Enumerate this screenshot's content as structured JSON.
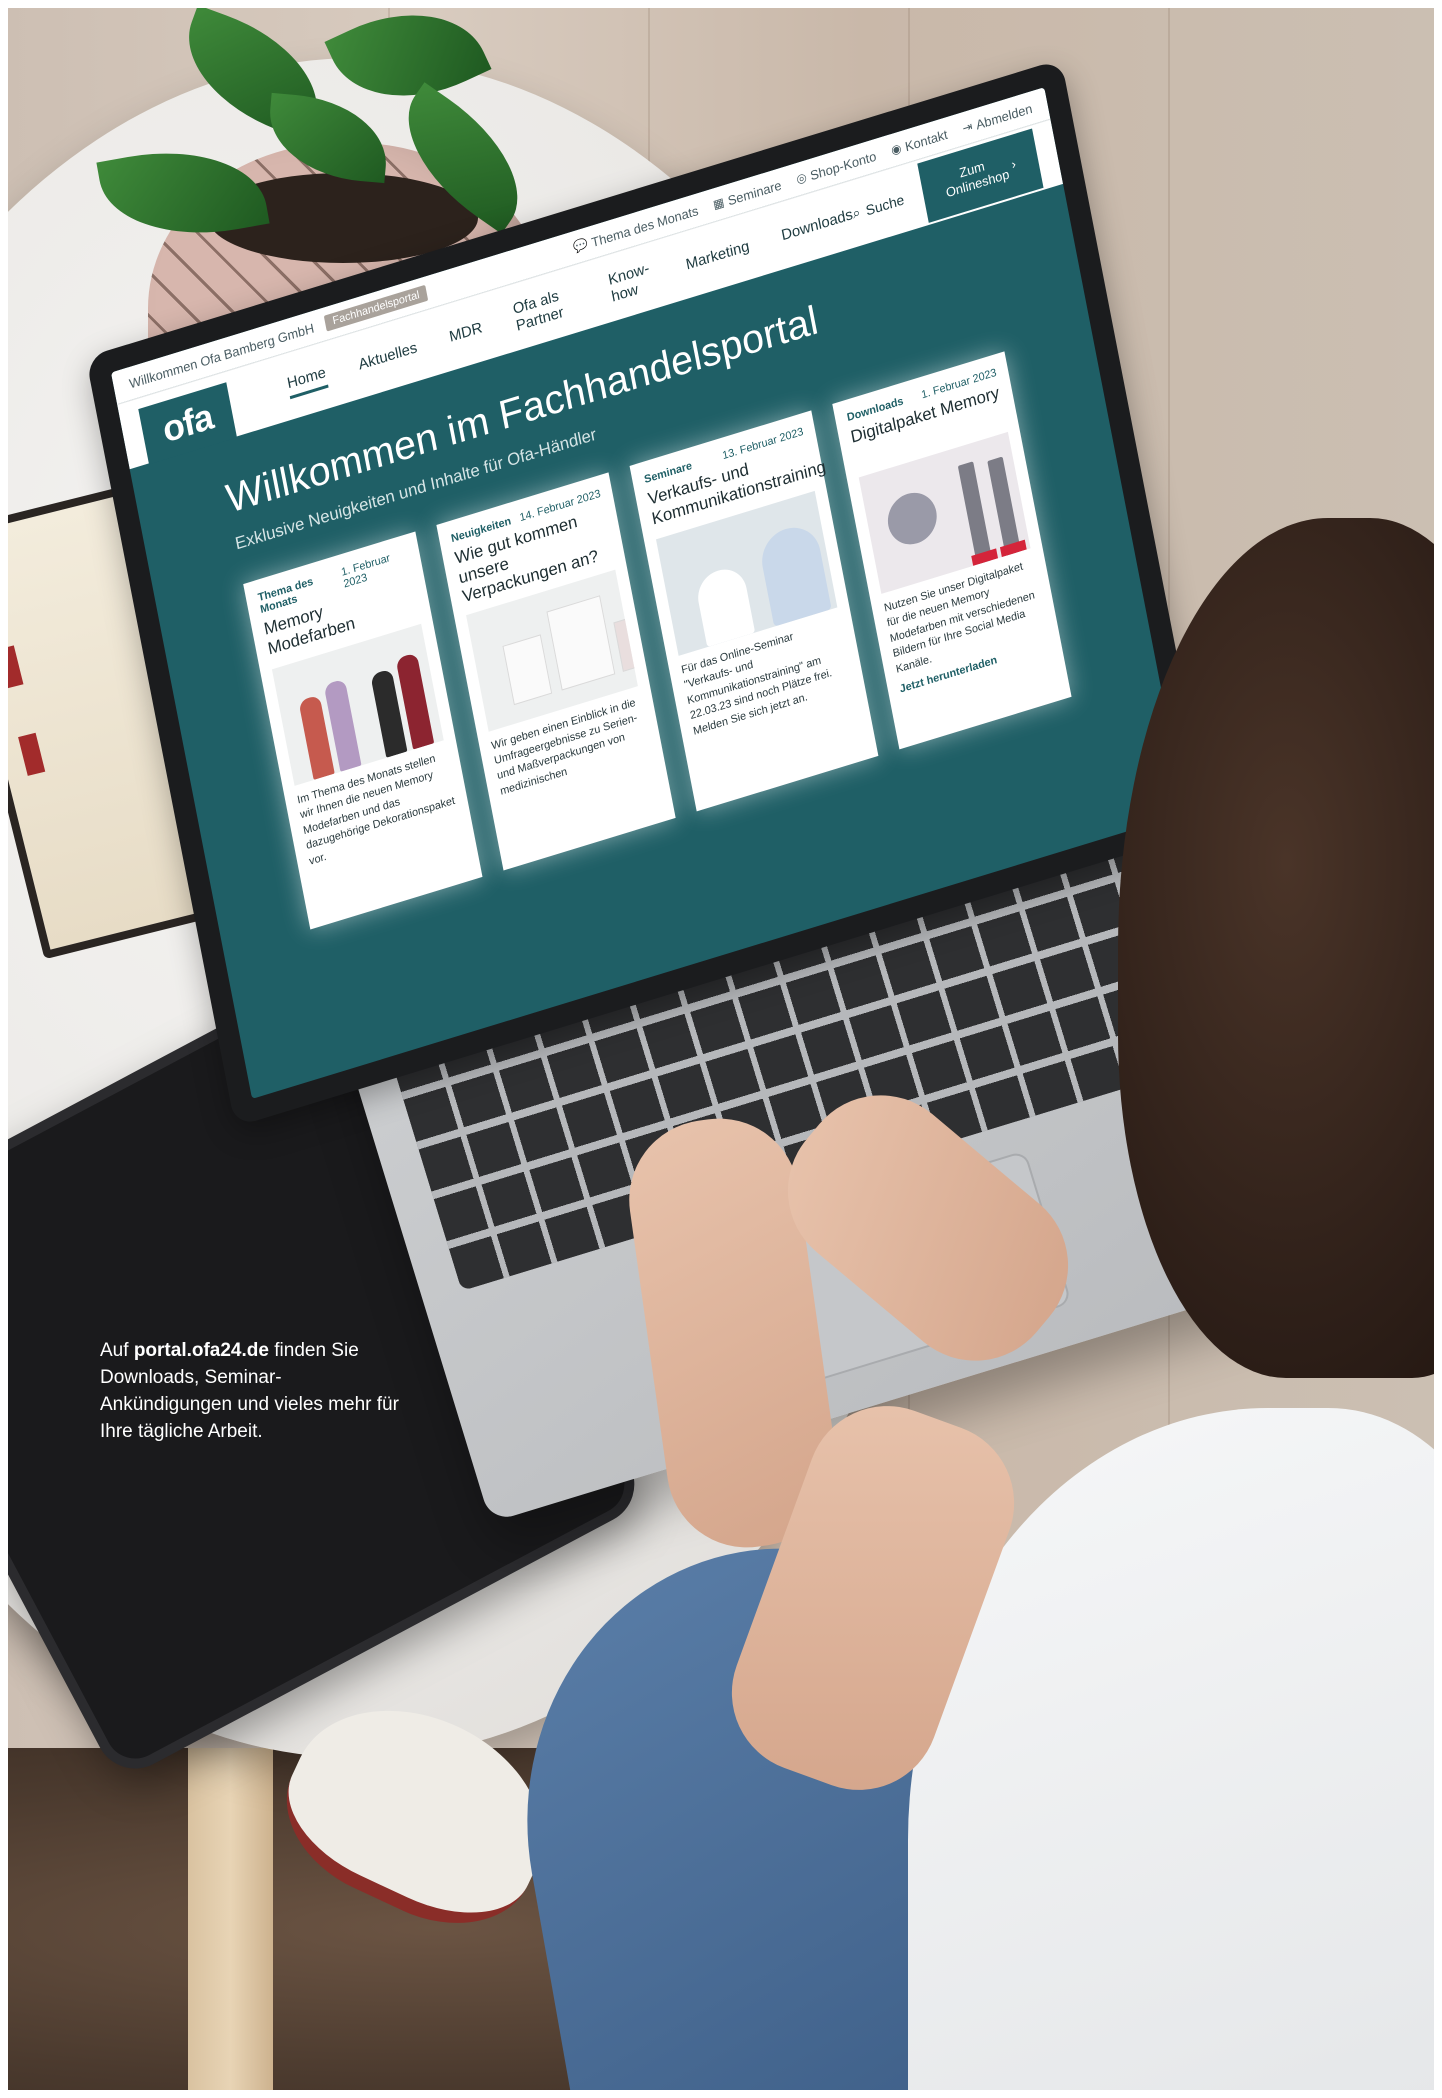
{
  "caption": {
    "prefix": "Auf ",
    "url": "portal.ofa24.de",
    "rest": " finden Sie Downloads, Seminar-Ankündigungen und vieles mehr für Ihre tägliche Arbeit."
  },
  "portal": {
    "util": {
      "welcome": "Willkommen Ofa Bamberg GmbH",
      "section_pill": "Fachhandelsportal",
      "items": [
        {
          "label": "Thema des Monats",
          "icon": "chat-icon"
        },
        {
          "label": "Seminare",
          "icon": "calendar-icon"
        },
        {
          "label": "Shop-Konto",
          "icon": "user-icon"
        },
        {
          "label": "Kontakt",
          "icon": "pin-icon"
        },
        {
          "label": "Abmelden",
          "icon": "logout-icon"
        }
      ]
    },
    "logo": "ofa",
    "nav": [
      "Home",
      "Aktuelles",
      "MDR",
      "Ofa als Partner",
      "Know-how",
      "Marketing",
      "Downloads"
    ],
    "search_label": "Suche",
    "shop_button": "Zum Onlineshop",
    "hero": {
      "title": "Willkommen im Fachhandelsportal",
      "subtitle": "Exklusive Neuigkeiten und Inhalte für Ofa-Händler"
    },
    "cards": [
      {
        "category": "Thema des Monats",
        "date": "1. Februar 2023",
        "title": "Memory Modefarben",
        "text": "Im Thema des Monats stellen wir Ihnen die neuen Memory Modefarben und das dazugehörige Dekorationspaket vor.",
        "link": ""
      },
      {
        "category": "Neuigkeiten",
        "date": "14. Februar 2023",
        "title": "Wie gut kommen unsere Verpackungen an?",
        "text": "Wir geben einen Einblick in die Umfrageergebnisse zu Serien- und Maßverpackungen von medizinischen",
        "link": ""
      },
      {
        "category": "Seminare",
        "date": "13. Februar 2023",
        "title": "Verkaufs- und Kommunikationstraining",
        "text": "Für das Online-Seminar \"Verkaufs- und Kommunikationstraining\" am 22.03.23 sind noch Plätze frei. Melden Sie sich jetzt an.",
        "link": ""
      },
      {
        "category": "Downloads",
        "date": "1. Februar 2023",
        "title": "Digitalpaket Memory",
        "text": "Nutzen Sie unser Digitalpaket für die neuen Memory Modefarben mit verschiedenen Bildern für Ihre Social Media Kanäle.",
        "link": "Jetzt herunterladen"
      }
    ]
  },
  "colors": {
    "portal_teal": "#1f5f66",
    "caption_text": "#ffffff"
  }
}
